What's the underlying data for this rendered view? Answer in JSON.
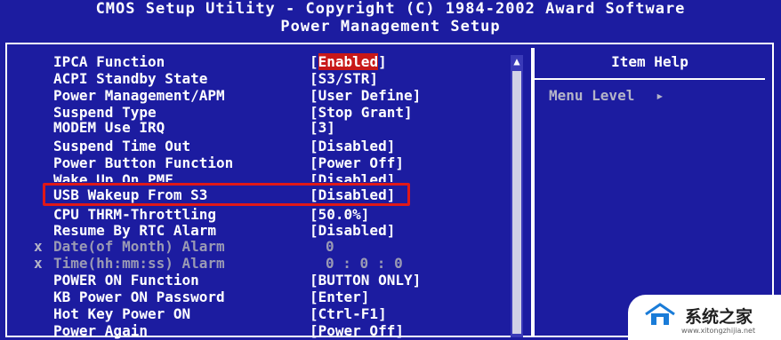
{
  "header": {
    "title": "CMOS Setup Utility - Copyright (C) 1984-2002 Award Software",
    "subtitle": "Power Management Setup"
  },
  "help": {
    "title": "Item Help",
    "menu_level": "Menu Level",
    "menu_level_arrow": "▸"
  },
  "items": [
    {
      "mark": "",
      "label": "IPCA Function",
      "value_pre": "[",
      "value_sel": "Enabled",
      "value_post": "]"
    },
    {
      "mark": "",
      "label": "ACPI Standby State",
      "value": "[S3/STR]"
    },
    {
      "mark": "",
      "label": "Power Management/APM",
      "value": "[User Define]"
    },
    {
      "mark": "",
      "label": "Suspend Type",
      "value": "[Stop Grant]"
    },
    {
      "mark": "",
      "label": "MODEM Use IRQ",
      "value": "[3]"
    },
    {
      "mark": "",
      "label": "Suspend Time Out",
      "value": "[Disabled]"
    },
    {
      "mark": "",
      "label": "Power Button Function",
      "value": "[Power Off]"
    },
    {
      "mark": "",
      "label": "Wake Up On PME",
      "value": "[Disabled]"
    },
    {
      "mark": "",
      "label": "USB Wakeup From S3",
      "value": "[Disabled]"
    },
    {
      "mark": "",
      "label": "CPU THRM-Throttling",
      "value": "[50.0%]"
    },
    {
      "mark": "",
      "label": "Resume By RTC Alarm",
      "value": "[Disabled]"
    },
    {
      "mark": "x",
      "label": "Date(of Month) Alarm",
      "value": "0"
    },
    {
      "mark": "x",
      "label": "Time(hh:mm:ss) Alarm",
      "value": "0 : 0 : 0"
    },
    {
      "mark": "",
      "label": "POWER ON Function",
      "value": "[BUTTON ONLY]"
    },
    {
      "mark": "",
      "label": "KB Power ON Password",
      "value": "[Enter]"
    },
    {
      "mark": "",
      "label": "Hot Key Power ON",
      "value": "[Ctrl-F1]"
    },
    {
      "mark": "",
      "label": "Power Again",
      "value": "[Power Off]"
    }
  ],
  "scrollbar": {
    "up_arrow": "▲"
  },
  "watermark": {
    "text": "系统之家",
    "subtext": "www.xitongzhijia.net"
  },
  "colors": {
    "background": "#1c1ca0",
    "text": "#ffffff",
    "dim_text": "#9a9ab4",
    "selection": "#c81818",
    "highlight_box": "#e01818"
  }
}
